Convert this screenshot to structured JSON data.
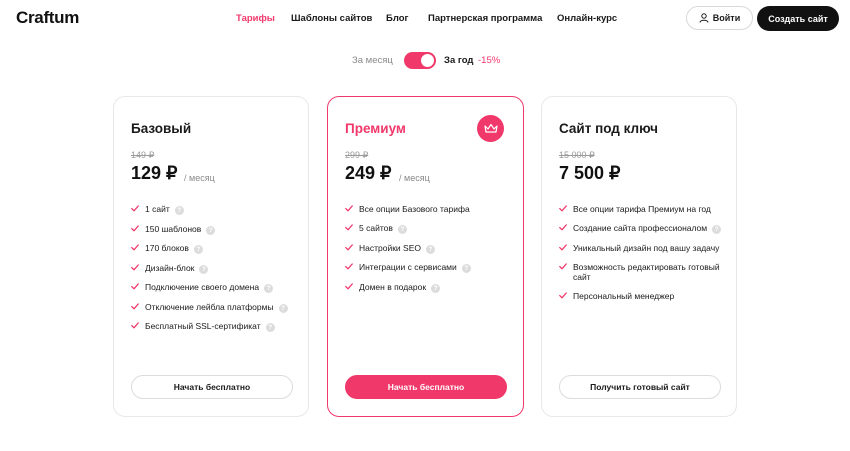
{
  "header": {
    "logo": "Craftum",
    "nav": [
      {
        "label": "Тарифы",
        "active": true
      },
      {
        "label": "Шаблоны сайтов",
        "active": false
      },
      {
        "label": "Блог",
        "active": false
      },
      {
        "label": "Партнерская программа",
        "active": false
      },
      {
        "label": "Онлайн-курс",
        "active": false
      }
    ],
    "login_label": "Войти",
    "login_icon": "user-icon",
    "create_label": "Создать сайт"
  },
  "billing": {
    "monthly_label": "За месяц",
    "yearly_label": "За год",
    "discount_label": "-15%",
    "yearly_selected": true
  },
  "plans": [
    {
      "title": "Базовый",
      "old_price": "149 ₽",
      "price": "129 ₽",
      "period": "/ месяц",
      "features": [
        {
          "text": "1 сайт",
          "help": true
        },
        {
          "text": "150 шаблонов",
          "help": true
        },
        {
          "text": "170 блоков",
          "help": true
        },
        {
          "text": "Дизайн-блок",
          "help": true
        },
        {
          "text": "Подключение своего домена",
          "help": true
        },
        {
          "text": "Отключение лейбла платформы",
          "help": true
        },
        {
          "text": "Бесплатный SSL-сертификат",
          "help": true
        }
      ],
      "button": "Начать бесплатно",
      "highlighted": false
    },
    {
      "title": "Премиум",
      "badge_icon": "crown-icon",
      "old_price": "299 ₽",
      "price": "249 ₽",
      "period": "/ месяц",
      "features": [
        {
          "text": "Все опции Базового тарифа",
          "help": false
        },
        {
          "text": "5 сайтов",
          "help": true
        },
        {
          "text": "Настройки SEO",
          "help": true
        },
        {
          "text": "Интеграции с сервисами",
          "help": true
        },
        {
          "text": "Домен в подарок",
          "help": true
        }
      ],
      "button": "Начать бесплатно",
      "highlighted": true
    },
    {
      "title": "Сайт под ключ",
      "old_price": "15 000 ₽",
      "price": "7 500 ₽",
      "period": "",
      "features": [
        {
          "text": "Все опции тарифа Премиум на год",
          "help": false
        },
        {
          "text": "Создание сайта профессионалом",
          "help": true
        },
        {
          "text": "Уникальный дизайн под вашу задачу",
          "help": false
        },
        {
          "text": "Возможность редактировать готовый сайт",
          "help": false
        },
        {
          "text": "Персональный менеджер",
          "help": false
        }
      ],
      "button": "Получить готовый сайт",
      "highlighted": false
    }
  ],
  "colors": {
    "accent": "#f0386b",
    "dark": "#111111",
    "muted": "#8a8a8a",
    "border": "#e8e8e8"
  }
}
